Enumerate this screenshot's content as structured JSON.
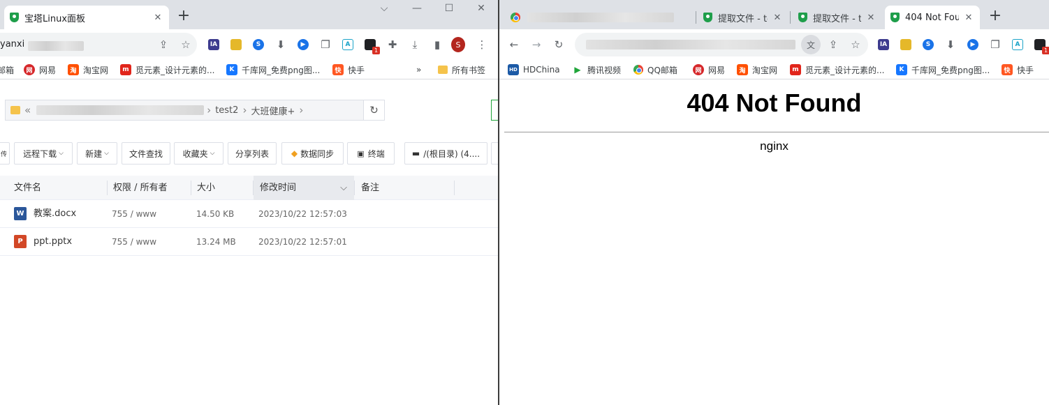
{
  "left_window": {
    "tabs": [
      {
        "title": "宝塔Linux面板",
        "icon": "shield-icon"
      }
    ],
    "address": {
      "partial_text": "yanxi"
    },
    "profile_initial": "S",
    "extensions": [
      "IA",
      "1"
    ],
    "bookmarks": [
      "邮箱",
      "网易",
      "淘宝网",
      "觅元素_设计元素的...",
      "千库网_免费png图...",
      "快手"
    ],
    "all_bookmarks": "所有书签",
    "file_manager": {
      "path": [
        "test2",
        "大班健康+"
      ],
      "buttons": [
        "远程下载",
        "新建",
        "文件查找",
        "收藏夹",
        "分享列表",
        "数据同步",
        "终端",
        "/(根目录) (4...."
      ],
      "columns": [
        "文件名",
        "权限 / 所有者",
        "大小",
        "修改时间",
        "备注"
      ],
      "files": [
        {
          "name": "教案.docx",
          "perm": "755 / www",
          "size": "14.50 KB",
          "mtime": "2023/10/22 12:57:03",
          "icon": "word-icon"
        },
        {
          "name": "ppt.pptx",
          "perm": "755 / www",
          "size": "13.24 MB",
          "mtime": "2023/10/22 12:57:01",
          "icon": "powerpoint-icon"
        }
      ]
    }
  },
  "right_window": {
    "tabs": [
      {
        "title": "提取文件 - te",
        "icon": "shield-icon"
      },
      {
        "title": "提取文件 - te",
        "icon": "shield-icon"
      },
      {
        "title": "404 Not Fou",
        "icon": "shield-icon"
      }
    ],
    "extensions": [
      "IA",
      "1"
    ],
    "bookmarks": [
      "HDChina",
      "腾讯视频",
      "QQ邮箱",
      "网易",
      "淘宝网",
      "觅元素_设计元素的...",
      "千库网_免费png图...",
      "快手"
    ],
    "page": {
      "heading": "404 Not Found",
      "server": "nginx"
    }
  },
  "colors": {
    "accent_green": "#20a53a",
    "tabstrip": "#dee1e6",
    "divider": "#3c3c3c"
  }
}
